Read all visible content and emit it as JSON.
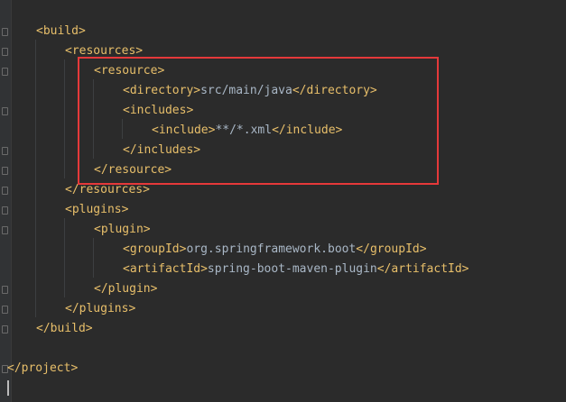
{
  "code_lines": [
    {
      "indent": 1,
      "parts": [
        {
          "k": "tag",
          "t": "<build>"
        }
      ]
    },
    {
      "indent": 2,
      "parts": [
        {
          "k": "tag",
          "t": "<resources>"
        }
      ]
    },
    {
      "indent": 3,
      "parts": [
        {
          "k": "tag",
          "t": "<resource>"
        }
      ]
    },
    {
      "indent": 4,
      "parts": [
        {
          "k": "tag",
          "t": "<directory>"
        },
        {
          "k": "txt",
          "t": "src/main/java"
        },
        {
          "k": "tag",
          "t": "</directory>"
        }
      ]
    },
    {
      "indent": 4,
      "parts": [
        {
          "k": "tag",
          "t": "<includes>"
        }
      ]
    },
    {
      "indent": 5,
      "parts": [
        {
          "k": "tag",
          "t": "<include>"
        },
        {
          "k": "txt",
          "t": "**/*.xml"
        },
        {
          "k": "tag",
          "t": "</include>"
        }
      ]
    },
    {
      "indent": 4,
      "parts": [
        {
          "k": "tag",
          "t": "</includes>"
        }
      ]
    },
    {
      "indent": 3,
      "parts": [
        {
          "k": "tag",
          "t": "</resource>"
        }
      ]
    },
    {
      "indent": 2,
      "parts": [
        {
          "k": "tag",
          "t": "</resources>"
        }
      ]
    },
    {
      "indent": 2,
      "parts": [
        {
          "k": "tag",
          "t": "<plugins>"
        }
      ]
    },
    {
      "indent": 3,
      "parts": [
        {
          "k": "tag",
          "t": "<plugin>"
        }
      ]
    },
    {
      "indent": 4,
      "parts": [
        {
          "k": "tag",
          "t": "<groupId>"
        },
        {
          "k": "txt",
          "t": "org.springframework.boot"
        },
        {
          "k": "tag",
          "t": "</groupId>"
        }
      ]
    },
    {
      "indent": 4,
      "parts": [
        {
          "k": "tag",
          "t": "<artifactId>"
        },
        {
          "k": "txt",
          "t": "spring-boot-maven-plugin"
        },
        {
          "k": "tag",
          "t": "</artifactId>"
        }
      ]
    },
    {
      "indent": 3,
      "parts": [
        {
          "k": "tag",
          "t": "</plugin>"
        }
      ]
    },
    {
      "indent": 2,
      "parts": [
        {
          "k": "tag",
          "t": "</plugins>"
        }
      ]
    },
    {
      "indent": 1,
      "parts": [
        {
          "k": "tag",
          "t": "</build>"
        }
      ]
    },
    {
      "indent": 0,
      "parts": []
    },
    {
      "indent": 0,
      "parts": [
        {
          "k": "tag",
          "t": "</project>"
        }
      ]
    }
  ],
  "colors": {
    "background": "#2b2b2b",
    "tag": "#e8bf6a",
    "text": "#a9b7c6",
    "highlight_box": "#e5393a"
  }
}
